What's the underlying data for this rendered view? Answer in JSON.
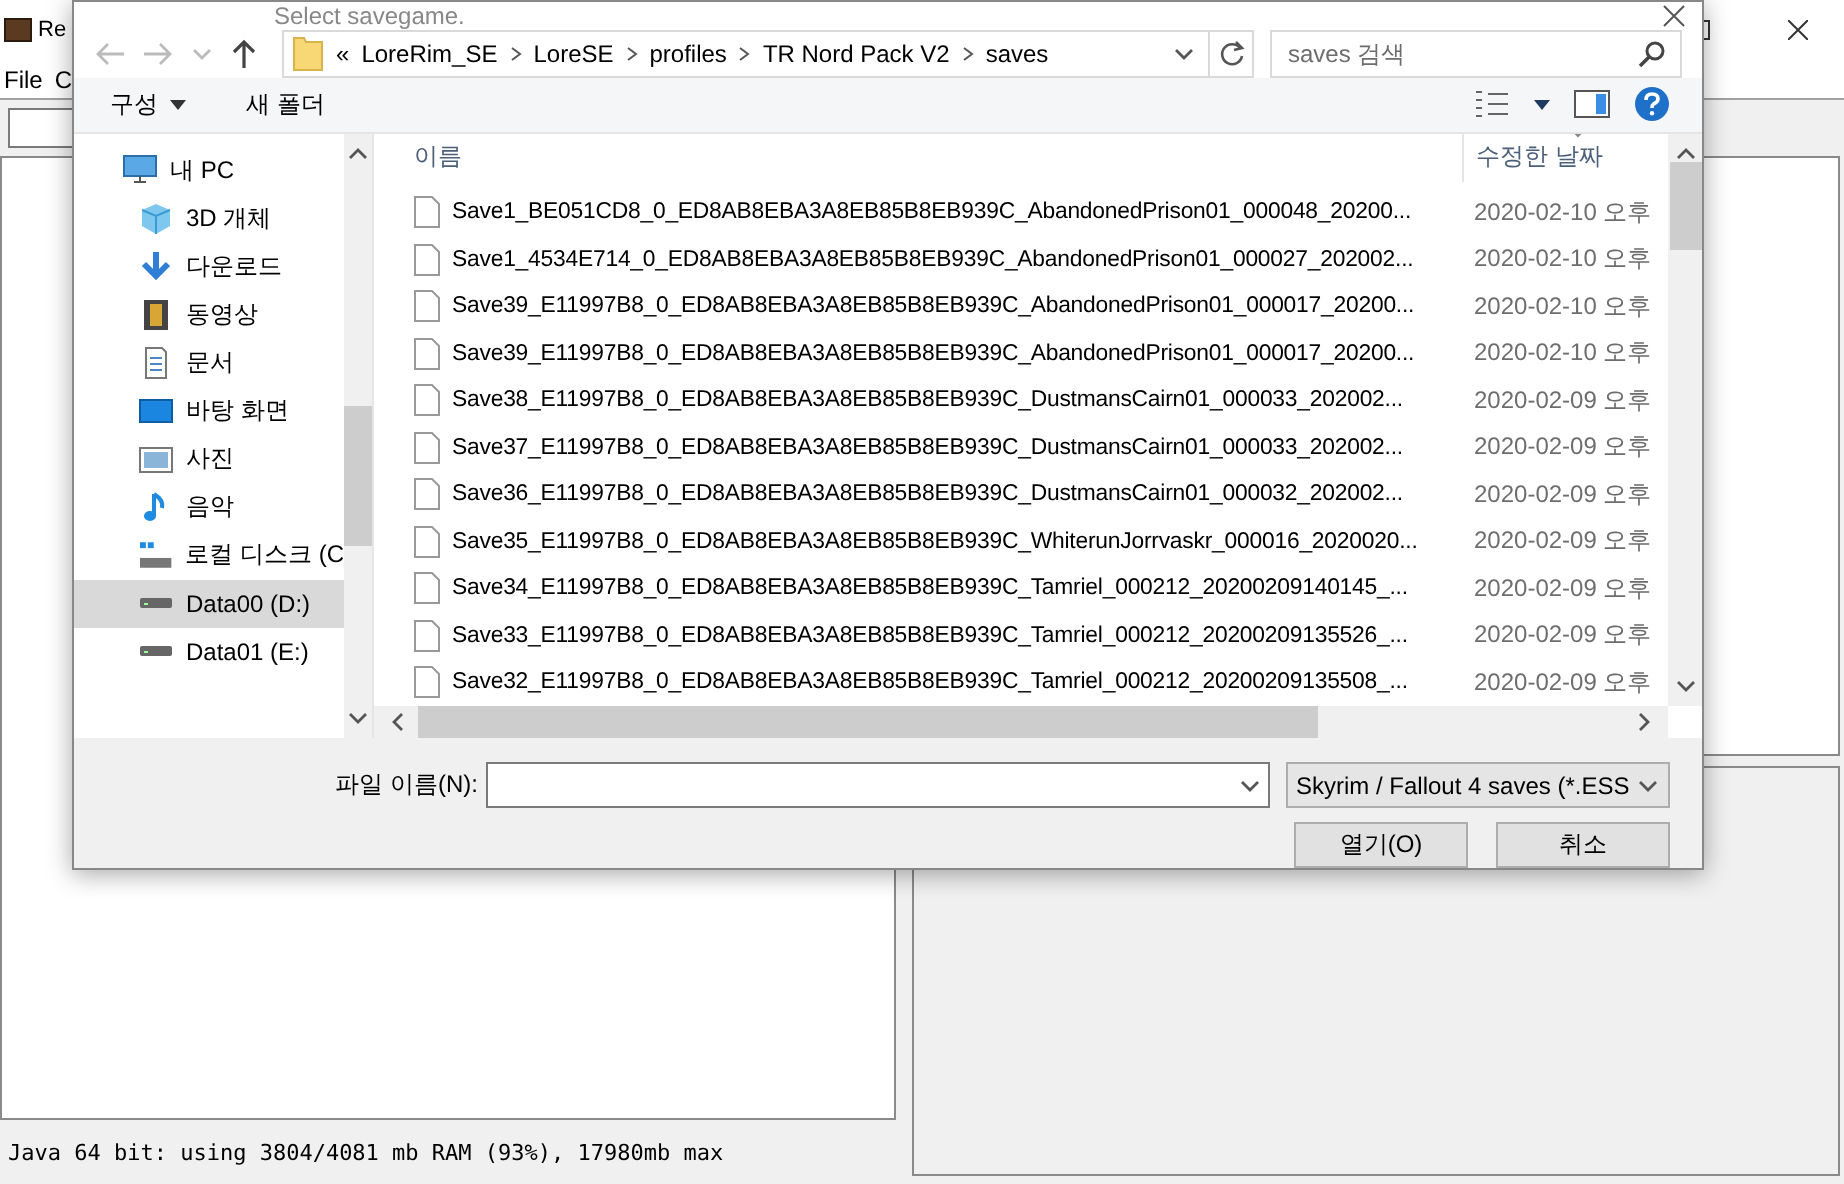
{
  "app": {
    "title": "Re",
    "menu": [
      "File",
      "C"
    ],
    "status_bar": "Java 64 bit: using 3804/4081 mb RAM (93%), 17980mb max"
  },
  "dialog": {
    "title": "Select savegame.",
    "address": {
      "overflow": "«",
      "path": [
        "LoreRim_SE",
        "LoreSE",
        "profiles",
        "TR Nord Pack V2",
        "saves"
      ]
    },
    "search": {
      "placeholder": "saves 검색"
    },
    "toolbar": {
      "organize": "구성",
      "new_folder": "새 폴더"
    },
    "nav": [
      {
        "label": "내 PC",
        "kind": "pc",
        "selected": false,
        "children": [
          {
            "label": "3D 개체",
            "kind": "cube",
            "selected": false
          },
          {
            "label": "다운로드",
            "kind": "download",
            "selected": false
          },
          {
            "label": "동영상",
            "kind": "video",
            "selected": false
          },
          {
            "label": "문서",
            "kind": "document",
            "selected": false
          },
          {
            "label": "바탕 화면",
            "kind": "desktop",
            "selected": false
          },
          {
            "label": "사진",
            "kind": "picture",
            "selected": false
          },
          {
            "label": "음악",
            "kind": "music",
            "selected": false
          },
          {
            "label": "로컬 디스크 (C",
            "kind": "system-drive",
            "selected": false
          },
          {
            "label": "Data00 (D:)",
            "kind": "drive",
            "selected": true
          },
          {
            "label": "Data01 (E:)",
            "kind": "drive",
            "selected": false
          }
        ]
      }
    ],
    "columns": [
      "이름",
      "수정한 날짜"
    ],
    "files": [
      {
        "name": "Save1_BE051CD8_0_ED8AB8EBA3A8EB85B8EB939C_AbandonedPrison01_000048_20200...",
        "date": "2020-02-10 오후"
      },
      {
        "name": "Save1_4534E714_0_ED8AB8EBA3A8EB85B8EB939C_AbandonedPrison01_000027_202002...",
        "date": "2020-02-10 오후"
      },
      {
        "name": "Save39_E11997B8_0_ED8AB8EBA3A8EB85B8EB939C_AbandonedPrison01_000017_20200...",
        "date": "2020-02-10 오후"
      },
      {
        "name": "Save39_E11997B8_0_ED8AB8EBA3A8EB85B8EB939C_AbandonedPrison01_000017_20200...",
        "date": "2020-02-10 오후"
      },
      {
        "name": "Save38_E11997B8_0_ED8AB8EBA3A8EB85B8EB939C_DustmansCairn01_000033_202002...",
        "date": "2020-02-09 오후"
      },
      {
        "name": "Save37_E11997B8_0_ED8AB8EBA3A8EB85B8EB939C_DustmansCairn01_000033_202002...",
        "date": "2020-02-09 오후"
      },
      {
        "name": "Save36_E11997B8_0_ED8AB8EBA3A8EB85B8EB939C_DustmansCairn01_000032_202002...",
        "date": "2020-02-09 오후"
      },
      {
        "name": "Save35_E11997B8_0_ED8AB8EBA3A8EB85B8EB939C_WhiterunJorrvaskr_000016_2020020...",
        "date": "2020-02-09 오후"
      },
      {
        "name": "Save34_E11997B8_0_ED8AB8EBA3A8EB85B8EB939C_Tamriel_000212_20200209140145_...",
        "date": "2020-02-09 오후"
      },
      {
        "name": "Save33_E11997B8_0_ED8AB8EBA3A8EB85B8EB939C_Tamriel_000212_20200209135526_...",
        "date": "2020-02-09 오후"
      },
      {
        "name": "Save32_E11997B8_0_ED8AB8EBA3A8EB85B8EB939C_Tamriel_000212_20200209135508_...",
        "date": "2020-02-09 오후"
      }
    ],
    "file_name": {
      "label": "파일 이름(N):"
    },
    "filter": "Skyrim / Fallout 4 saves (*.ESS",
    "buttons": [
      "열기(O)",
      "취소"
    ]
  }
}
